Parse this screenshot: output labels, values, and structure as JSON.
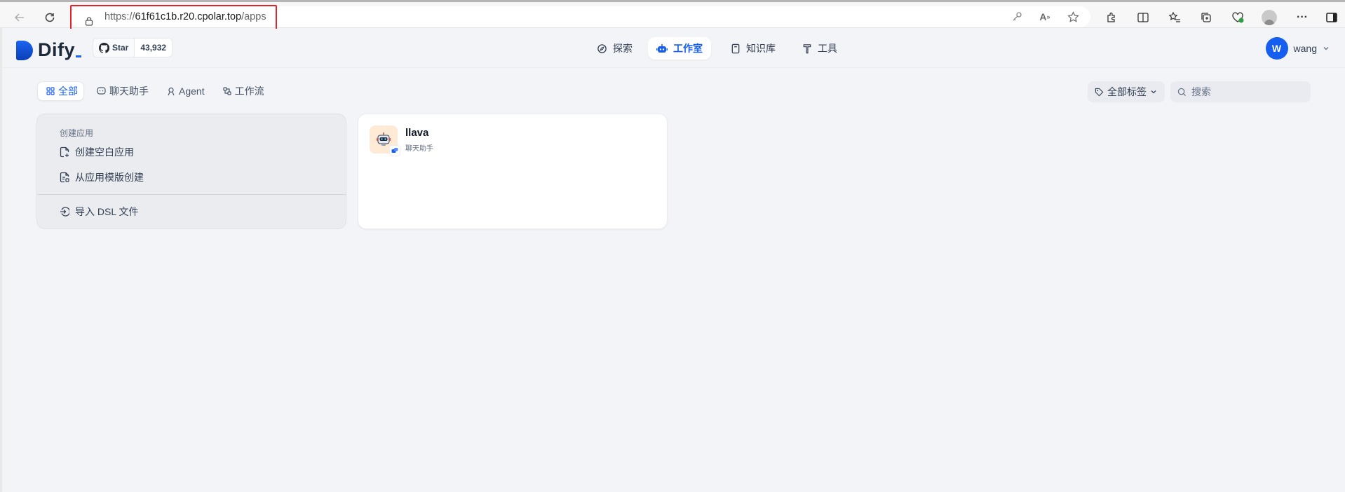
{
  "browser": {
    "url_prefix": "https://",
    "url_host": "61f61c1b.r20.cpolar.top",
    "url_path": "/apps",
    "icons": [
      "back-arrow-icon",
      "refresh-icon",
      "lock-icon",
      "key-icon",
      "read-aloud-icon",
      "favorite-star-icon",
      "extensions-icon",
      "split-screen-icon",
      "favorites-icon",
      "collections-icon",
      "browser-essentials-icon",
      "profile-icon",
      "more-icon",
      "sidebar-icon"
    ]
  },
  "header": {
    "logo_text": "Dify",
    "github_star_label": "Star",
    "github_star_count": "43,932",
    "nav": [
      {
        "label": "探索",
        "icon": "explore-icon",
        "active": false
      },
      {
        "label": "工作室",
        "icon": "robot-icon",
        "active": true
      },
      {
        "label": "知识库",
        "icon": "book-icon",
        "active": false
      },
      {
        "label": "工具",
        "icon": "hammer-icon",
        "active": false
      }
    ],
    "user": {
      "initial": "W",
      "name": "wang"
    }
  },
  "filters": {
    "tabs": [
      {
        "label": "全部",
        "icon": "grid-icon",
        "active": true
      },
      {
        "label": "聊天助手",
        "icon": "chat-icon",
        "active": false
      },
      {
        "label": "Agent",
        "icon": "agent-icon",
        "active": false
      },
      {
        "label": "工作流",
        "icon": "workflow-icon",
        "active": false
      }
    ],
    "tag_filter_label": "全部标签",
    "search_placeholder": "搜索"
  },
  "create_card": {
    "heading": "创建应用",
    "options": [
      {
        "label": "创建空白应用",
        "icon": "file-plus-icon"
      },
      {
        "label": "从应用模版创建",
        "icon": "file-template-icon"
      }
    ],
    "import_label": "导入 DSL 文件"
  },
  "apps": [
    {
      "name": "llava",
      "type": "聊天助手",
      "icon_bg": "#ffead5"
    }
  ],
  "colors": {
    "accent": "#155eef",
    "page_bg": "#f2f4f7",
    "highlight_border": "#e3222b"
  }
}
